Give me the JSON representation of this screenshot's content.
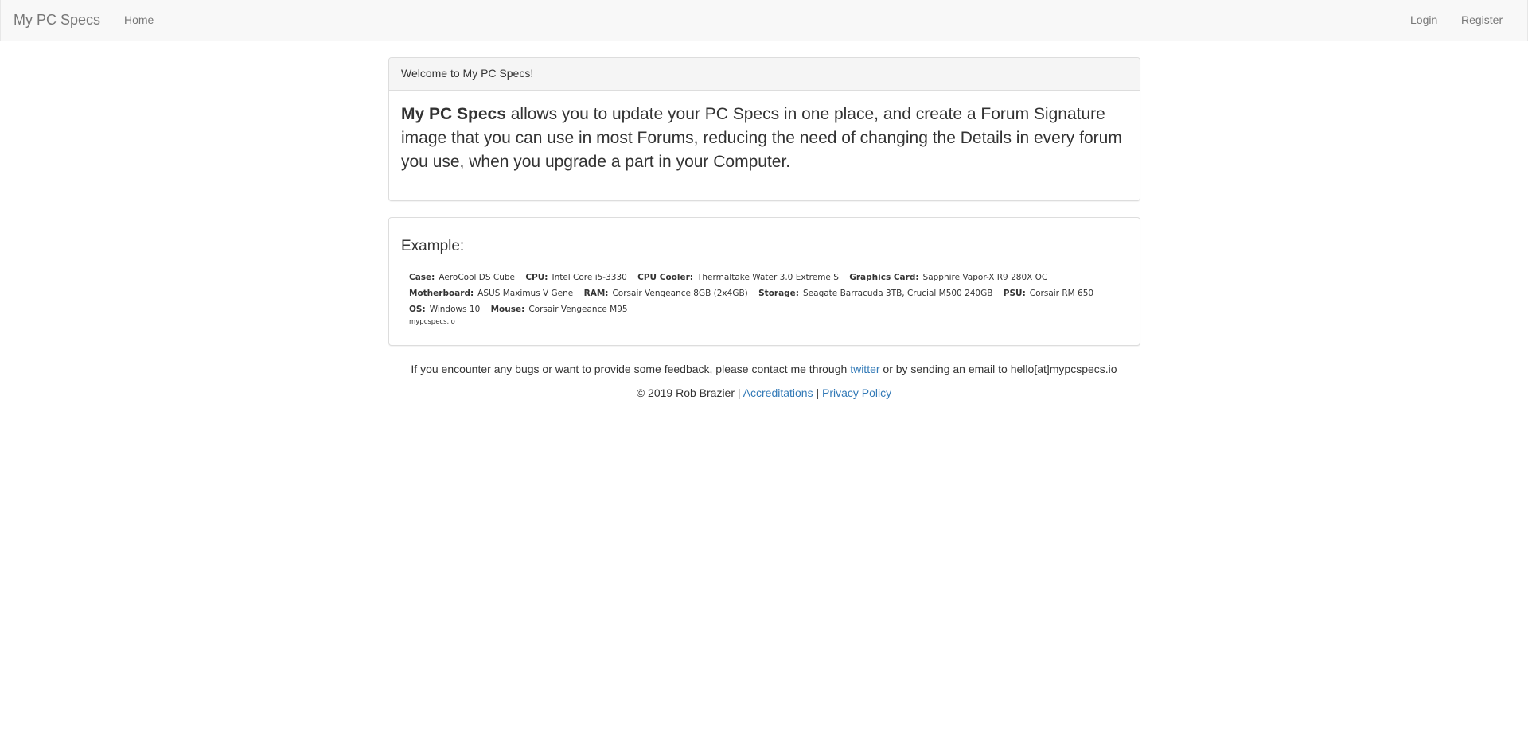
{
  "navbar": {
    "brand": "My PC Specs",
    "home": "Home",
    "login": "Login",
    "register": "Register"
  },
  "welcome": {
    "heading": "Welcome to My PC Specs!",
    "lead_strong": "My PC Specs",
    "lead_text": " allows you to update your PC Specs in one place, and create a Forum Signature image that you can use in most Forums, reducing the need of changing the Details in every forum you use, when you upgrade a part in your Computer."
  },
  "example": {
    "title": "Example:",
    "lines": [
      [
        {
          "label": "Case:",
          "value": "AeroCool DS Cube"
        },
        {
          "label": "CPU:",
          "value": "Intel Core i5-3330"
        },
        {
          "label": "CPU Cooler:",
          "value": "Thermaltake Water 3.0 Extreme S"
        },
        {
          "label": "Graphics Card:",
          "value": "Sapphire Vapor-X R9 280X OC"
        }
      ],
      [
        {
          "label": "Motherboard:",
          "value": "ASUS Maximus V Gene"
        },
        {
          "label": "RAM:",
          "value": "Corsair Vengeance 8GB (2x4GB)"
        },
        {
          "label": "Storage:",
          "value": "Seagate Barracuda 3TB,  Crucial M500 240GB"
        },
        {
          "label": "PSU:",
          "value": "Corsair RM 650"
        }
      ],
      [
        {
          "label": "OS:",
          "value": "Windows 10"
        },
        {
          "label": "Mouse:",
          "value": "Corsair Vengeance M95"
        }
      ]
    ],
    "url": "mypcspecs.io"
  },
  "footer": {
    "feedback_before": "If you encounter any bugs or want to provide some feedback, please contact me through ",
    "twitter": "twitter",
    "feedback_after": " or by sending an email to hello[at]mypcspecs.io",
    "copyright": "© 2019 Rob Brazier | ",
    "accreditations": "Accreditations",
    "separator": " | ",
    "privacy": "Privacy Policy"
  },
  "colors": {
    "link": "#337ab7",
    "navbar_bg": "#f8f8f8",
    "panel_heading_bg": "#f5f5f5",
    "text": "#333333",
    "nav_text": "#777777"
  }
}
